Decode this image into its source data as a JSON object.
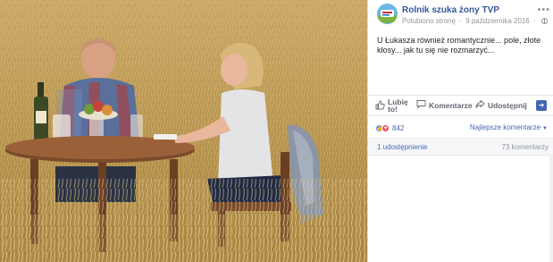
{
  "post": {
    "page_name": "Rolnik szuka żony TVP",
    "liked_label": "Polubiono stronę",
    "separator": "·",
    "date": "9 października 2016",
    "text": "U Łukasza również romantycznie... pole, złote kłosy... jak tu się nie rozmarzyć..."
  },
  "actions": {
    "like_label": "Lubię to!",
    "comment_label": "Komentarze",
    "share_label": "Udostępnij"
  },
  "reactions": {
    "count": "842",
    "sort_label": "Najlepsze komentarze"
  },
  "stats": {
    "shares": "1 udostępnienie",
    "comments": "73 komentarzy"
  },
  "icons": {
    "more": "more-options-icon",
    "globe": "globe-icon",
    "like": "thumbs-up-icon",
    "comment": "comment-bubble-icon",
    "share": "share-arrow-icon",
    "love": "heart-icon"
  },
  "colors": {
    "link": "#365899",
    "accent": "#4267b2",
    "meta": "#90949c",
    "field": "#c8a660"
  }
}
